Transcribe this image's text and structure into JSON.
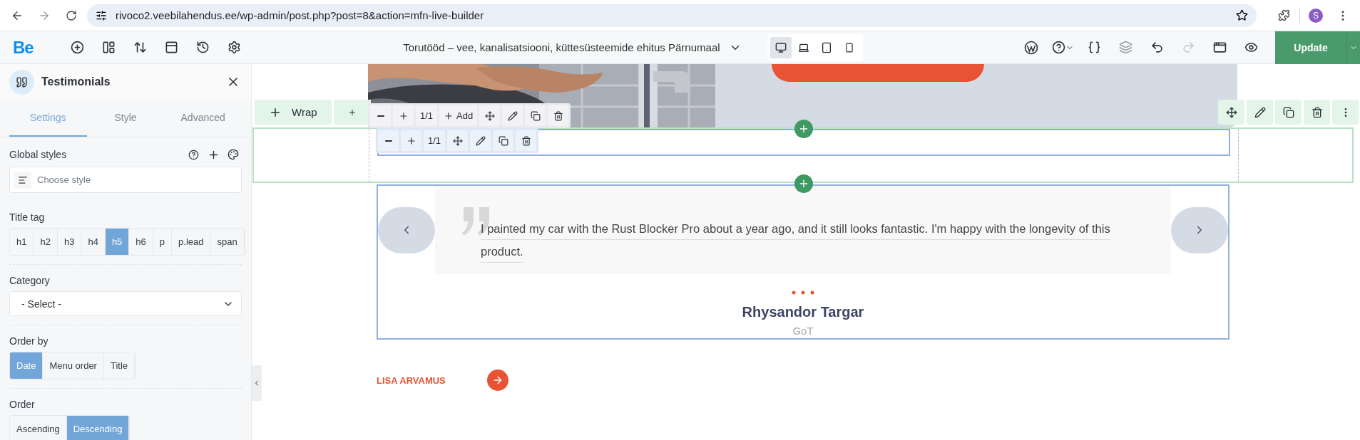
{
  "browser": {
    "url": "rivoco2.veebilahendus.ee/wp-admin/post.php?post=8&action=mfn-live-builder",
    "profile_initial": "S"
  },
  "builder_toolbar": {
    "logo": "Be",
    "page_title": "Torutööd – vee, kanalisatsiooni, küttesüsteemide ehitus Pärnumaal",
    "devices": [
      {
        "kind": "desktop",
        "selected": true
      },
      {
        "kind": "laptop",
        "selected": false
      },
      {
        "kind": "tablet",
        "selected": false
      },
      {
        "kind": "mobile",
        "selected": false
      }
    ],
    "update_label": "Update"
  },
  "panel": {
    "title": "Testimonials",
    "tabs": [
      {
        "label": "Settings",
        "selected": true
      },
      {
        "label": "Style",
        "selected": false
      },
      {
        "label": "Advanced",
        "selected": false
      }
    ],
    "global_styles": {
      "label": "Global styles",
      "placeholder": "Choose style"
    },
    "title_tag": {
      "label": "Title tag",
      "options": [
        {
          "label": "h1",
          "selected": false
        },
        {
          "label": "h2",
          "selected": false
        },
        {
          "label": "h3",
          "selected": false
        },
        {
          "label": "h4",
          "selected": false
        },
        {
          "label": "h5",
          "selected": true
        },
        {
          "label": "h6",
          "selected": false
        },
        {
          "label": "p",
          "selected": false
        },
        {
          "label": "p.lead",
          "selected": false
        },
        {
          "label": "span",
          "selected": false
        }
      ]
    },
    "category": {
      "label": "Category",
      "value": "- Select -"
    },
    "order_by": {
      "label": "Order by",
      "options": [
        {
          "label": "Date",
          "selected": true
        },
        {
          "label": "Menu order",
          "selected": false
        },
        {
          "label": "Title",
          "selected": false
        }
      ]
    },
    "order": {
      "label": "Order",
      "options": [
        {
          "label": "Ascending",
          "selected": false
        },
        {
          "label": "Descending",
          "selected": true
        }
      ]
    }
  },
  "canvas": {
    "wrap_toolbar": {
      "wrap_label": "Wrap"
    },
    "element_toolbar": {
      "counter": "1/1",
      "add_label": "Add"
    },
    "inner_toolbar": {
      "counter": "1/1"
    },
    "testimonial": {
      "quote": "I painted my car with the Rust Blocker Pro about a year ago, and it still looks fantastic. I'm happy with the longevity of this product.",
      "name": "Rhysandor Targar",
      "group": "GoT"
    },
    "link": {
      "label": "LISA ARVAMUS"
    }
  }
}
